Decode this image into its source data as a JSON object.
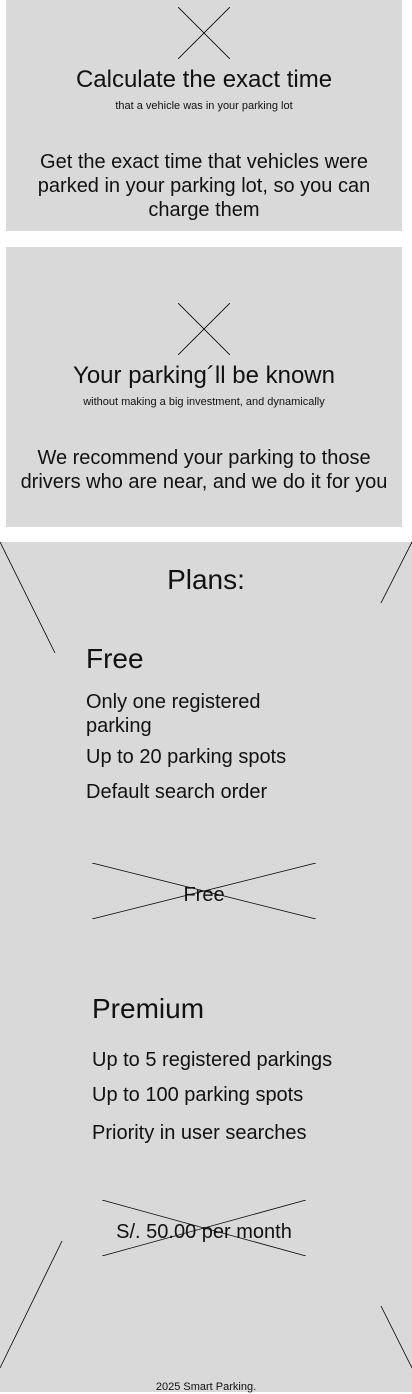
{
  "features": [
    {
      "icon": "placeholder-image-icon",
      "title": "Calculate the exact time",
      "subtitle": "that a vehicle was in your parking lot",
      "description": "Get the exact time that vehicles were parked in your parking lot, so you can charge them"
    },
    {
      "icon": "placeholder-image-icon",
      "title": "Your parking´ll be known",
      "subtitle": "without making a big investment, and dynamically",
      "description": "We recommend your parking to those drivers who are near, and we do it for you"
    }
  ],
  "plans": {
    "title": "Plans:",
    "items": [
      {
        "name": "Free",
        "features": [
          "Only one registered parking",
          "Up to 20 parking spots",
          "Default search order"
        ],
        "price": "Free"
      },
      {
        "name": "Premium",
        "features": [
          "Up to 5 registered parkings",
          "Up to 100 parking spots",
          "Priority in user searches"
        ],
        "price": "S/. 50.00 per month"
      }
    ]
  },
  "footer": {
    "text": "2025 Smart Parking."
  },
  "colors": {
    "card_background": "#d9d9d9",
    "text": "#111111",
    "line": "#000000"
  }
}
